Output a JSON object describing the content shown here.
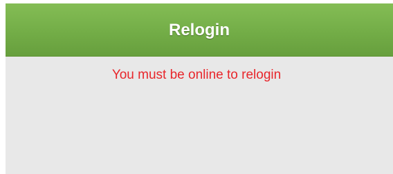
{
  "header": {
    "title": "Relogin"
  },
  "main": {
    "message": "You must be online to relogin"
  },
  "colors": {
    "header_green": "#73ad47",
    "message_red": "#e8262b",
    "panel_background": "#e8e8e8"
  }
}
